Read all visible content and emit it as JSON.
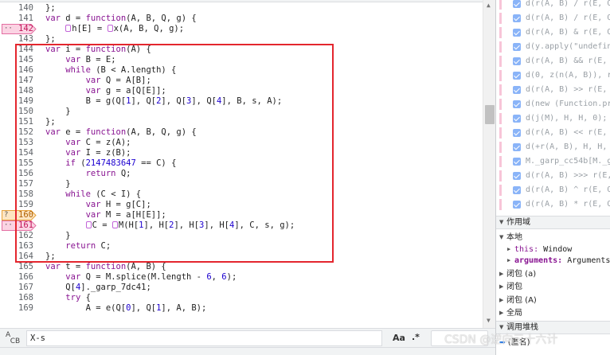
{
  "editor": {
    "lines": [
      {
        "n": "140",
        "html": "};"
      },
      {
        "n": "141",
        "kind": "var-fn",
        "name": "d",
        "params": "A, B, Q, g"
      },
      {
        "n": "142",
        "bp": "pink",
        "call": [
          "h[E] = ",
          "x(A, B, Q, g);"
        ]
      },
      {
        "n": "143",
        "text": "};"
      },
      {
        "n": "144",
        "kind": "var-fn",
        "name": "i",
        "params": "A"
      },
      {
        "n": "145",
        "text": "    var B = E;"
      },
      {
        "n": "146",
        "text": "    while (B < A.length) {"
      },
      {
        "n": "147",
        "text": "        var Q = A[B];"
      },
      {
        "n": "148",
        "text": "        var g = a[Q[E]];"
      },
      {
        "n": "149",
        "text": "        B = g(Q[1], Q[2], Q[3], Q[4], B, s, A);"
      },
      {
        "n": "150",
        "text": "    }"
      },
      {
        "n": "151",
        "text": "};"
      },
      {
        "n": "152",
        "kind": "var-fn",
        "name": "e",
        "params": "A, B, Q, g"
      },
      {
        "n": "153",
        "text": "    var C = z(A);"
      },
      {
        "n": "154",
        "text": "    var I = z(B);"
      },
      {
        "n": "155",
        "text": "    if (2147483647 == C) {"
      },
      {
        "n": "156",
        "text": "        return Q;"
      },
      {
        "n": "157",
        "text": "    }"
      },
      {
        "n": "158",
        "text": "    while (C < I) {"
      },
      {
        "n": "159",
        "text": "        var H = g[C];"
      },
      {
        "n": "160",
        "bp": "orange",
        "text": "        var M = a[H[E]];"
      },
      {
        "n": "161",
        "bp": "pink",
        "call2": [
          "C = ",
          "M(H[1], H[2], H[3], H[4], C, s, g);"
        ]
      },
      {
        "n": "162",
        "text": "    }"
      },
      {
        "n": "163",
        "text": "    return C;"
      },
      {
        "n": "164",
        "text": "};"
      },
      {
        "n": "165",
        "kind": "var-fn",
        "name": "t",
        "params": "A, B"
      },
      {
        "n": "166",
        "text": "    var Q = M.splice(M.length - 6, 6);"
      },
      {
        "n": "167",
        "text": "    Q[4]._garp_7dc41;"
      },
      {
        "n": "168",
        "text": "    try {"
      },
      {
        "n": "169",
        "text": "        A = e(Q[0], Q[1], A, B);"
      }
    ],
    "bp_labels": {
      "pink": "··",
      "orange": "?"
    }
  },
  "search": {
    "query": "X-s",
    "case_label": "Aa",
    "regex_label": ".*"
  },
  "sidebar": {
    "breakpoints": [
      "d(r(A, B) / r(E, Q",
      "d(r(A, B) / r(E, Q",
      "d(r(A, B) & r(E, Q",
      "d(y.apply(\"undefin",
      "d(r(A, B) && r(E, ",
      "d(0, z(n(A, B)), r",
      "d(r(A, B) >> r(E, ",
      "d(new (Function.pro",
      "d(j(M), H, H, 0);",
      "d(r(A, B) << r(E, ",
      "d(+r(A, B), H, H, 0",
      "M._garp_cc54b[M._ga",
      "d(r(A, B) >>> r(E, ",
      "d(r(A, B) ^ r(E, Q",
      "d(r(A, B) * r(E, Q"
    ],
    "scope_title": "作用域",
    "local_label": "本地",
    "this_key": "this:",
    "this_val": "Window",
    "args_key": "arguments:",
    "args_val": "Arguments",
    "closures": [
      "闭包 (a)",
      "闭包",
      "闭包 (A)"
    ],
    "global_label": "全局",
    "callstack_title": "调用堆栈",
    "anon_label": "(匿名)"
  },
  "watermark": "CSDN @逆向三十六计",
  "colors": {
    "highlight": "#e4262e",
    "keyword": "#881391",
    "number": "#1c00cf"
  }
}
